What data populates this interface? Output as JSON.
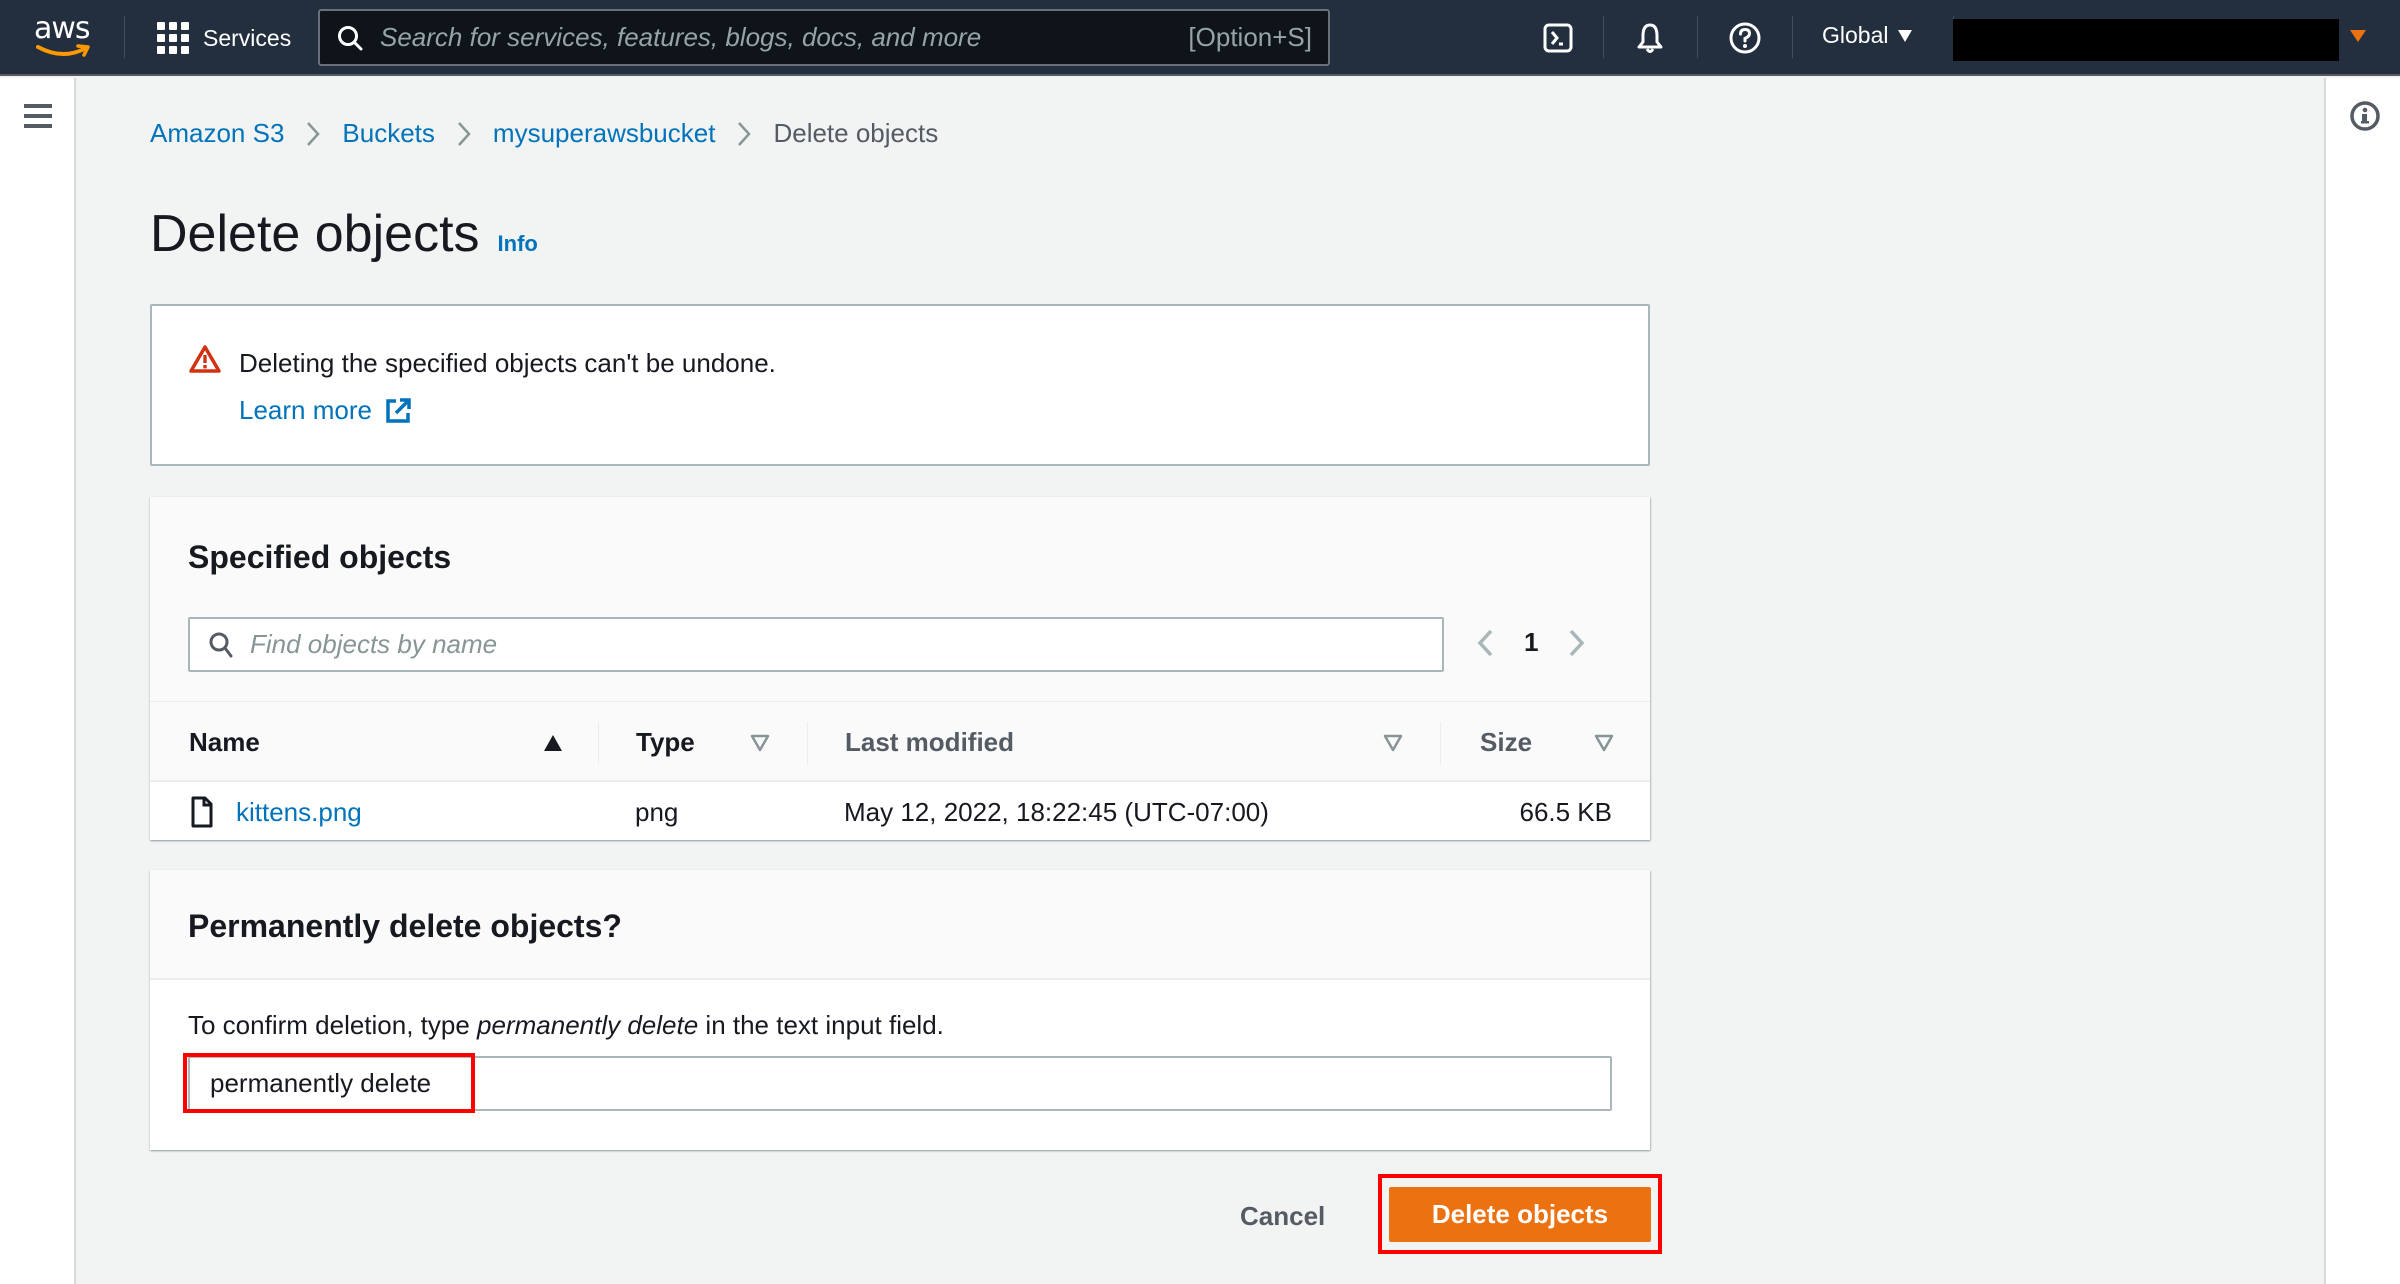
{
  "topnav": {
    "logo": "aws",
    "services_label": "Services",
    "search_placeholder": "Search for services, features, blogs, docs, and more",
    "search_shortcut": "[Option+S]",
    "icons": [
      "cloudshell-icon",
      "bell-icon",
      "help-icon"
    ],
    "region_label": "Global",
    "account_label": ""
  },
  "breadcrumb": [
    {
      "label": "Amazon S3"
    },
    {
      "label": "Buckets"
    },
    {
      "label": "mysuperawsbucket"
    },
    {
      "label": "Delete objects"
    }
  ],
  "page": {
    "title": "Delete objects",
    "info_link": "Info"
  },
  "alert": {
    "type": "warning",
    "message": "Deleting the specified objects can't be undone.",
    "learn_more": "Learn more"
  },
  "specified_objects": {
    "title": "Specified objects",
    "search_placeholder": "Find objects by name",
    "current_page": "1",
    "columns": [
      {
        "label": "Name",
        "sort": "ascending"
      },
      {
        "label": "Type",
        "sort": "none"
      },
      {
        "label": "Last modified",
        "sort": "none"
      },
      {
        "label": "Size",
        "sort": "none"
      }
    ],
    "rows": [
      {
        "name": "kittens.png",
        "type": "png",
        "last_modified": "May 12, 2022, 18:22:45 (UTC-07:00)",
        "size": "66.5 KB"
      }
    ]
  },
  "permanent_delete": {
    "title": "Permanently delete objects?",
    "instruction_prefix": "To confirm deletion, type ",
    "instruction_phrase": "permanently delete",
    "instruction_suffix": " in the text input field.",
    "input_value": "permanently delete"
  },
  "actions": {
    "cancel_label": "Cancel",
    "delete_label": "Delete objects"
  },
  "colors": {
    "nav_bg": "#232f3e",
    "link": "#0073bb",
    "primary_button": "#ec7211",
    "warning": "#d13212",
    "highlight": "#ff0000"
  }
}
